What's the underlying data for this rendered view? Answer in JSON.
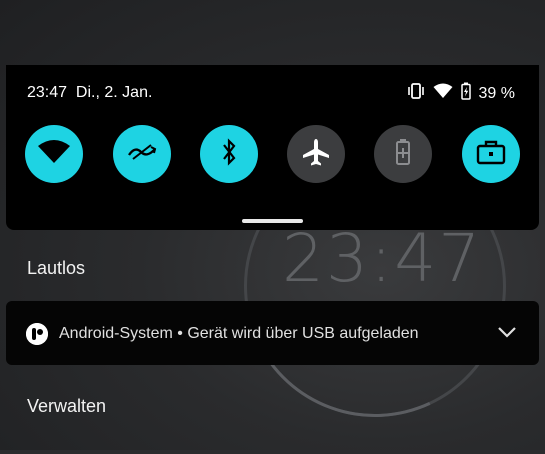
{
  "status_bar": {
    "time_date": "23:47  Di., 2. Jan.",
    "battery": "39 %",
    "icons": [
      "vibrate-icon",
      "wifi-icon",
      "battery-charging-icon"
    ]
  },
  "quick_settings": {
    "tiles": [
      {
        "name": "wifi",
        "icon": "wifi-icon",
        "state": "on"
      },
      {
        "name": "data-saver",
        "icon": "data-saver-icon",
        "state": "on"
      },
      {
        "name": "bluetooth",
        "icon": "bluetooth-icon",
        "state": "on"
      },
      {
        "name": "airplane-mode",
        "icon": "airplane-icon",
        "state": "off"
      },
      {
        "name": "battery-saver",
        "icon": "battery-saver-icon",
        "state": "off"
      },
      {
        "name": "work-profile",
        "icon": "briefcase-icon",
        "state": "on"
      }
    ],
    "accent_color": "#1ed3e3",
    "inactive_color": "#3c3d3f"
  },
  "background_clock": "23:47",
  "sections": {
    "silent_title": "Lautlos",
    "manage_title": "Verwalten"
  },
  "notification": {
    "text": "Android-System • Gerät wird über USB aufgeladen",
    "icon": "android-system-icon"
  }
}
